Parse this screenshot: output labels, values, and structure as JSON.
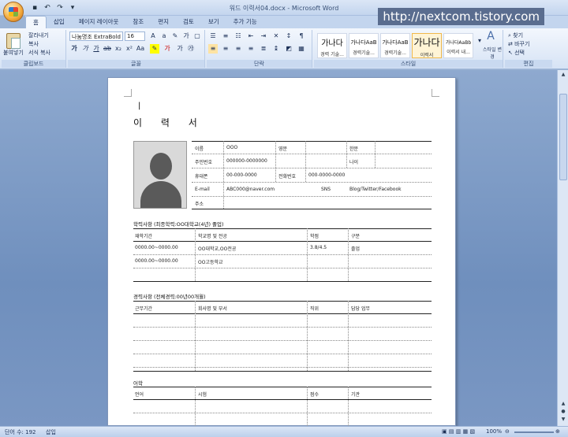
{
  "window": {
    "title": "워드 이력서04.docx - Microsoft Word",
    "watermark": "http://nextcom.tistory.com"
  },
  "quick_access": [
    "save-icon",
    "undo-icon",
    "redo-icon",
    "customize-icon"
  ],
  "tabs": [
    "홈",
    "삽입",
    "페이지 레이아웃",
    "참조",
    "편지",
    "검토",
    "보기",
    "추가 기능"
  ],
  "ribbon": {
    "clipboard": {
      "paste": "붙여넣기",
      "cut": "잘라내기",
      "copy": "복사",
      "format_painter": "서식 복사",
      "label": "클립보드"
    },
    "font": {
      "name": "나눔명조 ExtraBold",
      "size": "16",
      "label": "글꼴"
    },
    "paragraph": {
      "label": "단락"
    },
    "styles": {
      "items": [
        {
          "preview": "가나다",
          "name": "경력 기술..."
        },
        {
          "preview": "가나다AaB",
          "name": "경력기술..."
        },
        {
          "preview": "가나다AaB",
          "name": "경력기술..."
        },
        {
          "preview": "가나다",
          "name": "이력서"
        },
        {
          "preview": "가나다AaBb",
          "name": "이력서 내..."
        }
      ],
      "change": "스타일 변경",
      "label": "스타일"
    },
    "editing": {
      "find": "찾기",
      "replace": "바꾸기",
      "select": "선택",
      "label": "편집"
    }
  },
  "document": {
    "title": "이 력 서",
    "personal": {
      "name_label": "이름",
      "name_value": "OOO",
      "eng_label": "영문",
      "eng_value": "",
      "hanja_label": "한문",
      "hanja_value": "",
      "id_label": "주민번호",
      "id_value": "000000-0000000",
      "age_label": "나이",
      "age_value": "",
      "mobile_label": "휴대폰",
      "mobile_value": "00-000-0000",
      "phone_label": "전화번호",
      "phone_value": "000-0000-0000",
      "email_label": "E-mail",
      "email_value": "ABC000@naver.com",
      "sns_label": "SNS",
      "sns_value": "Blog/Twitter/Facebook",
      "addr_label": "주소",
      "addr_value": ""
    },
    "education": {
      "heading": "학력사항 (최종학력:OO대학교(4년) 졸업)",
      "headers": [
        "재학기간",
        "학교명 및 전공",
        "학점",
        "구분"
      ],
      "rows": [
        [
          "0000.00~0000.00",
          "OO대학교,OO전공",
          "3.8/4.5",
          "졸업"
        ],
        [
          "0000.00~0000.00",
          "OO고등학교",
          "",
          ""
        ],
        [
          "",
          "",
          "",
          ""
        ]
      ]
    },
    "career": {
      "heading": "경력사항 (전체경력:00년00개월)",
      "headers": [
        "근무기간",
        "회사명 및 부서",
        "직위",
        "담당 업무"
      ],
      "rows": [
        [
          "",
          "",
          "",
          ""
        ],
        [
          "",
          "",
          "",
          ""
        ],
        [
          "",
          "",
          "",
          ""
        ],
        [
          "",
          "",
          "",
          ""
        ],
        [
          "",
          "",
          "",
          ""
        ]
      ]
    },
    "language": {
      "heading": "어학",
      "headers": [
        "언어",
        "시험",
        "점수",
        "기관"
      ]
    }
  },
  "status": {
    "words": "단어 수: 192",
    "mode": "삽입",
    "zoom": "100%"
  }
}
